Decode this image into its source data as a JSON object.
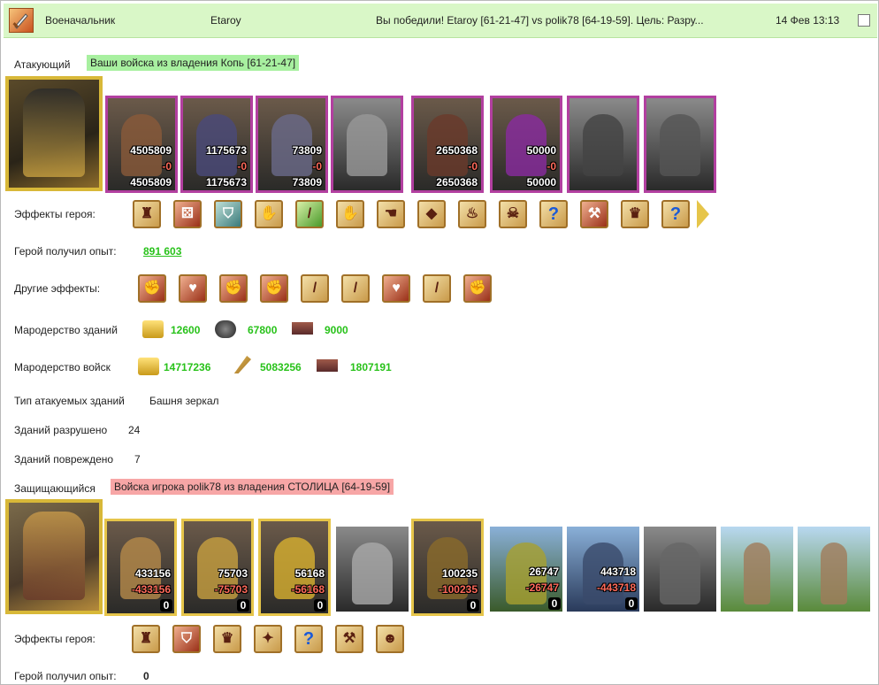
{
  "header": {
    "role": "Военачальник",
    "player": "Etaroy",
    "message": "Вы победили! Etaroy [61-21-47] vs polik78 [64-19-59]. Цель: Разру...",
    "date": "14 Фев 13:13"
  },
  "attacker": {
    "label": "Атакующий",
    "banner": "Ваши войска из владения Копь [61-21-47]",
    "units": [
      {
        "a": "4505809",
        "b": "-0",
        "c": "4505809"
      },
      {
        "a": "1175673",
        "b": "-0",
        "c": "1175673"
      },
      {
        "a": "73809",
        "b": "-0",
        "c": "73809"
      },
      {
        "a": "",
        "b": "",
        "c": ""
      },
      {
        "a": "2650368",
        "b": "-0",
        "c": "2650368"
      },
      {
        "a": "50000",
        "b": "-0",
        "c": "50000"
      },
      {
        "a": "",
        "b": "",
        "c": ""
      },
      {
        "a": "",
        "b": "",
        "c": ""
      }
    ],
    "hero_effects_label": "Эффекты героя:",
    "hero_effects": [
      "shield-tower",
      "dice",
      "shield",
      "handshake",
      "sword",
      "handshake",
      "hand",
      "gems",
      "fire-coin",
      "skull-coin",
      "question",
      "axe-totem",
      "totem",
      "question"
    ],
    "exp_label": "Герой получил опыт:",
    "exp_value": "891 603",
    "other_effects_label": "Другие эффекты:",
    "other_effects": [
      "sword-fist",
      "heart-sword",
      "fist",
      "sword-fist",
      "sword",
      "sword",
      "heart-sword",
      "sword",
      "fist"
    ],
    "loot_buildings_label": "Мародерство зданий",
    "loot_buildings": [
      "12600",
      "67800",
      "9000"
    ],
    "loot_troops_label": "Мародерство войск",
    "loot_troops": [
      "14717236",
      "5083256",
      "1807191"
    ],
    "building_type_label": "Тип атакуемых зданий",
    "building_type": "Башня зеркал",
    "destroyed_label": "Зданий разрушено",
    "destroyed": "24",
    "damaged_label": "Зданий повреждено",
    "damaged": "7"
  },
  "defender": {
    "label": "Защищающийся",
    "banner": "Войска игрока polik78 из владения СТОЛИЦА [64-19-59]",
    "units": [
      {
        "a": "433156",
        "b": "-433156",
        "c": "0"
      },
      {
        "a": "75703",
        "b": "-75703",
        "c": "0"
      },
      {
        "a": "56168",
        "b": "-56168",
        "c": "0"
      },
      {
        "a": "",
        "b": "",
        "c": ""
      },
      {
        "a": "100235",
        "b": "-100235",
        "c": "0"
      },
      {
        "a": "26747",
        "b": "-26747",
        "c": "0"
      },
      {
        "a": "443718",
        "b": "-443718",
        "c": "0"
      },
      {
        "a": "",
        "b": "",
        "c": ""
      },
      {
        "a": "",
        "b": "",
        "c": ""
      },
      {
        "a": "",
        "b": "",
        "c": ""
      }
    ],
    "hero_effects_label": "Эффекты героя:",
    "hero_effects": [
      "tower",
      "shield",
      "crown",
      "totem",
      "question",
      "axe",
      "shield-face"
    ],
    "exp_label": "Герой получил опыт:",
    "exp_value": "0"
  }
}
